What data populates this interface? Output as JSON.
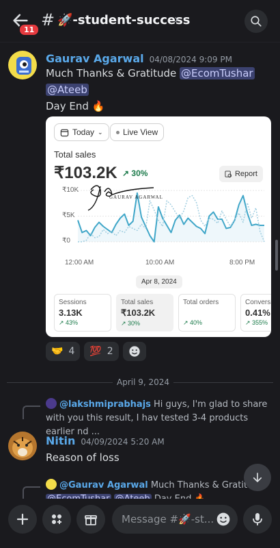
{
  "header": {
    "badge_count": "11",
    "hash": "#",
    "channel_name": "🚀-student-success",
    "chevron": "›",
    "icons": {
      "back": "back-arrow-icon",
      "search": "search-icon"
    }
  },
  "message1": {
    "author": "Gaurav Agarwal",
    "timestamp": "04/08/2024 9:09 PM",
    "text_prefix": "Much Thanks & Gratitude ",
    "mention1": "@EcomTushar",
    "mention2": "@Ateeb",
    "line2": "Day End 🔥"
  },
  "attachment": {
    "range_label": "Today",
    "live_label": "Live View",
    "total_label": "Total sales",
    "total_value": "₹103.2K",
    "total_change": "↗ 30%",
    "report_label": "Report",
    "watermark_signature": "ga",
    "watermark_name": "GAURAV AGARWAL",
    "date_chip": "Apr 8, 2024",
    "stats": [
      {
        "label": "Sessions",
        "value": "3.13K",
        "change": "↗ 43%"
      },
      {
        "label": "Total sales",
        "value": "₹103.2K",
        "change": "↗ 30%"
      },
      {
        "label": "Total orders",
        "value": "",
        "change": "↗ 40%"
      },
      {
        "label": "Conversi",
        "value": "0.41%",
        "change": "↗ 355%"
      }
    ]
  },
  "chart_data": {
    "type": "line",
    "y_ticks": [
      "₹10K",
      "₹5K",
      "₹0"
    ],
    "x_ticks": [
      "12:00 AM",
      "10:00 AM",
      "8:00 PM"
    ],
    "ylim": [
      0,
      10000
    ],
    "series": [
      {
        "style": "solid",
        "color": "#3fa6c8",
        "values": [
          4200,
          1800,
          2200,
          1200,
          2800,
          3800,
          3000,
          2400,
          1800,
          3400,
          4600,
          5400,
          3200,
          4000,
          9500,
          4800,
          3000,
          1200,
          0,
          6800,
          4600,
          3200,
          1800,
          4200,
          5200,
          3400,
          4600,
          3800,
          3000,
          2600,
          1600,
          5000,
          5800,
          4400,
          4400,
          2600,
          2800,
          4200,
          7200,
          9000,
          5600,
          3200,
          3400,
          3200,
          3200
        ]
      },
      {
        "style": "dashed",
        "color": "#9fcde0",
        "values": [
          0,
          0,
          300,
          1600,
          800,
          1000,
          2400,
          1600,
          2000,
          1200,
          2200,
          1800,
          3000,
          2600,
          2200,
          3400,
          2600,
          8000,
          6200,
          4200,
          3000,
          8000,
          7200,
          5800,
          4600,
          6000,
          8600,
          9000,
          7600,
          4200,
          3000,
          4600,
          4400,
          3600,
          6000,
          4400,
          3000,
          4400,
          5600,
          3800,
          7600,
          4600,
          6600,
          2000,
          0
        ]
      }
    ]
  },
  "reactions": [
    {
      "emoji": "🤝",
      "count": "4"
    },
    {
      "emoji": "💯",
      "count": "2"
    }
  ],
  "add_reaction_icon": "smiley-add-icon",
  "date_divider": "April 9, 2024",
  "reply1": {
    "author": "@lakshmiprabhajs",
    "text": "Hi guys, I'm glad to share with you this result, I hav tested 3-4 products earlier nd ..."
  },
  "message2": {
    "author": "Nitin",
    "timestamp": "04/09/2024 5:20 AM",
    "text": "Reason of loss"
  },
  "reply2": {
    "author": "@Gaurav Agarwal",
    "text": "Much Thanks & Gratitud",
    "mention1": "@EcomTushar",
    "mention2": "@Ateeb",
    "text_end": "Day End 🔥"
  },
  "composer": {
    "placeholder": "Message #🚀-st...",
    "icons": [
      "plus-icon",
      "apps-icon",
      "gift-icon",
      "emoji-icon",
      "microphone-icon"
    ]
  }
}
